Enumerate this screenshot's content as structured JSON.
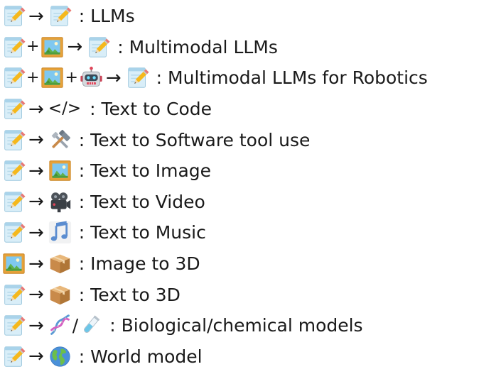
{
  "colors": {
    "text": "#1a1a1a",
    "background": "#ffffff"
  },
  "rows": [
    {
      "inputs": [
        "memo-icon"
      ],
      "output": "memo-icon",
      "label": ": LLMs"
    },
    {
      "inputs": [
        "memo-icon",
        "framed-picture-icon"
      ],
      "output": "memo-icon",
      "label": ": Multimodal LLMs"
    },
    {
      "inputs": [
        "memo-icon",
        "framed-picture-icon",
        "robot-icon"
      ],
      "output": "memo-icon",
      "label": ": Multimodal LLMs for Robotics"
    },
    {
      "inputs": [
        "memo-icon"
      ],
      "output": "code-symbol",
      "output_text": "</>",
      "label": ": Text to Code"
    },
    {
      "inputs": [
        "memo-icon"
      ],
      "output": "hammer-and-wrench-icon",
      "label": ": Text to Software tool use"
    },
    {
      "inputs": [
        "memo-icon"
      ],
      "output": "framed-picture-icon",
      "label": ": Text to Image"
    },
    {
      "inputs": [
        "memo-icon"
      ],
      "output": "movie-camera-icon",
      "label": ": Text to Video"
    },
    {
      "inputs": [
        "memo-icon"
      ],
      "output": "musical-notes-icon",
      "label": ": Text to Music"
    },
    {
      "inputs": [
        "framed-picture-icon"
      ],
      "output": "package-icon",
      "label": ": Image to 3D"
    },
    {
      "inputs": [
        "memo-icon"
      ],
      "output": "package-icon",
      "label": ": Text to 3D"
    },
    {
      "inputs": [
        "memo-icon"
      ],
      "output": "dna-and-test-tube-icons",
      "output_text": "/",
      "label": ": Biological/chemical models"
    },
    {
      "inputs": [
        "memo-icon"
      ],
      "output": "globe-icon",
      "label": ": World model"
    }
  ],
  "symbols": {
    "plus": "+",
    "arrow": "→"
  }
}
